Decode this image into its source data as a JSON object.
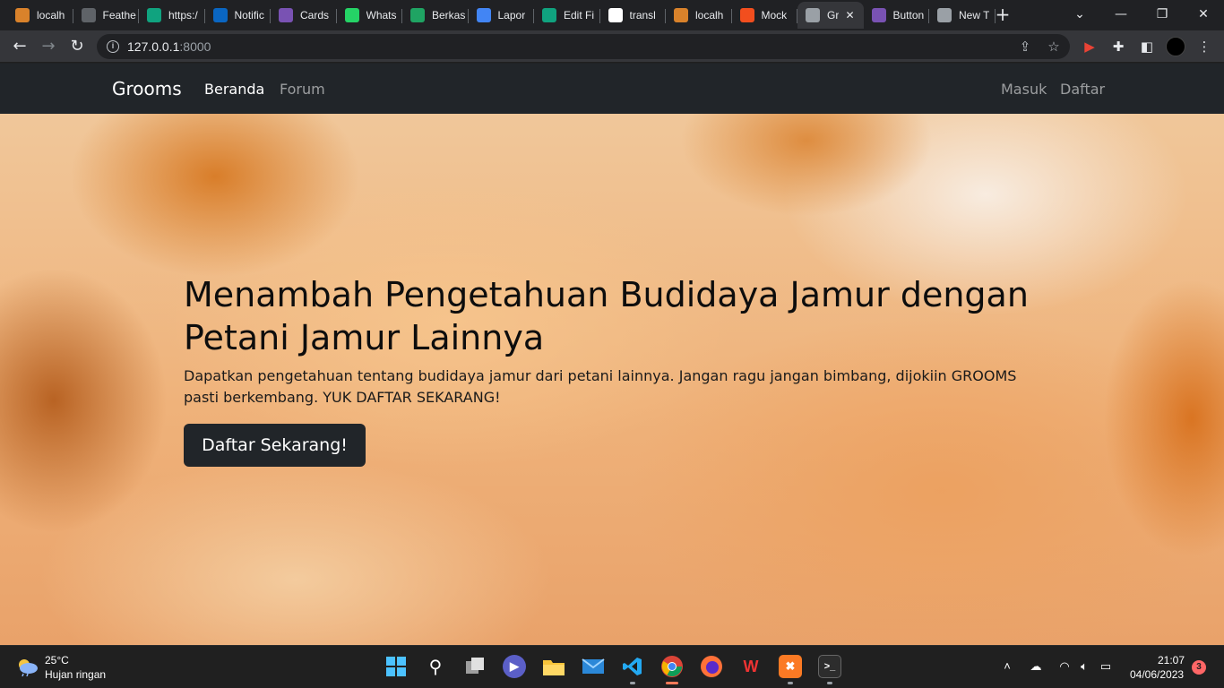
{
  "browser": {
    "tabs": [
      {
        "title": "localh",
        "icon": "xampp-icon",
        "color": "#d9822b"
      },
      {
        "title": "Feathe",
        "icon": "feather-icon",
        "color": "#5f6368"
      },
      {
        "title": "https:/",
        "icon": "chatgpt-icon",
        "color": "#10a37f"
      },
      {
        "title": "Notific",
        "icon": "linkedin-icon",
        "color": "#0a66c2"
      },
      {
        "title": "Cards",
        "icon": "bootstrap-icon",
        "color": "#7952b3"
      },
      {
        "title": "Whats",
        "icon": "whatsapp-icon",
        "color": "#25d366"
      },
      {
        "title": "Berkas",
        "icon": "google-drive-icon",
        "color": "#1fa463"
      },
      {
        "title": "Lapor",
        "icon": "google-docs-icon",
        "color": "#4285f4"
      },
      {
        "title": "Edit Fi",
        "icon": "chatgpt-icon",
        "color": "#10a37f"
      },
      {
        "title": "transl",
        "icon": "google-icon",
        "color": "#ffffff"
      },
      {
        "title": "localh",
        "icon": "xampp-icon",
        "color": "#d9822b"
      },
      {
        "title": "Mock",
        "icon": "figma-icon",
        "color": "#f24e1e"
      },
      {
        "title": "Gr",
        "icon": "globe-icon",
        "color": "#9aa0a6",
        "active": true
      },
      {
        "title": "Button",
        "icon": "bootstrap-icon",
        "color": "#7952b3"
      },
      {
        "title": "New T",
        "icon": "chrome-icon",
        "color": "#9aa0a6"
      }
    ],
    "url_host": "127.0.0.1",
    "url_port": ":8000"
  },
  "site": {
    "brand": "Grooms",
    "nav": {
      "home": "Beranda",
      "forum": "Forum",
      "login": "Masuk",
      "register": "Daftar"
    },
    "hero": {
      "title": "Menambah Pengetahuan Budidaya Jamur dengan Petani Jamur Lainnya",
      "text": "Dapatkan pengetahuan tentang budidaya jamur dari petani lainnya. Jangan ragu jangan bimbang, dijokiin GROOMS pasti berkembang. YUK DAFTAR SEKARANG!",
      "cta": "Daftar Sekarang!"
    }
  },
  "taskbar": {
    "weather_temp": "25°C",
    "weather_desc": "Hujan ringan",
    "time": "21:07",
    "date": "04/06/2023",
    "notifications": "3"
  },
  "colors": {
    "navbar_bg": "#212529",
    "button_bg": "#212529",
    "chrome_dark": "#202124",
    "chrome_toolbar": "#35363a"
  }
}
